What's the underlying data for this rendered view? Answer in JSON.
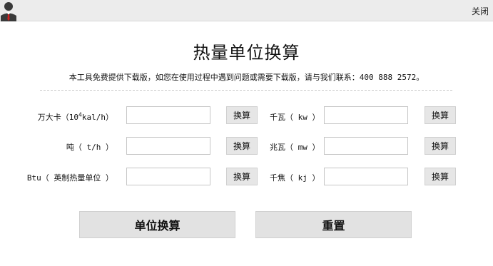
{
  "window": {
    "close_label": "关闭"
  },
  "header": {
    "title": "热量单位换算",
    "notice": "本工具免费提供下载版，如您在使用过程中遇到问题或需要下载版，请与我们联系：400 888 2572。"
  },
  "units": {
    "wandaka": {
      "label_prefix": "万大卡（10",
      "label_sup": "4",
      "label_suffix": "kal/h）",
      "value": "",
      "button": "换算"
    },
    "qianwa": {
      "label": "千瓦（ kw ）",
      "value": "",
      "button": "换算"
    },
    "dun": {
      "label": "吨（ t/h ）",
      "value": "",
      "button": "换算"
    },
    "zhaowa": {
      "label": "兆瓦（ mw ）",
      "value": "",
      "button": "换算"
    },
    "btu": {
      "label": "Btu（ 英制热量单位 ）",
      "value": "",
      "button": "换算"
    },
    "qianjiao": {
      "label": "千焦（ kj ）",
      "value": "",
      "button": "换算"
    }
  },
  "actions": {
    "convert_label": "单位换算",
    "reset_label": "重置"
  },
  "colors": {
    "topbar": "#ececec",
    "button_bg": "#e2e2e2",
    "tie_red": "#d21f1f"
  }
}
